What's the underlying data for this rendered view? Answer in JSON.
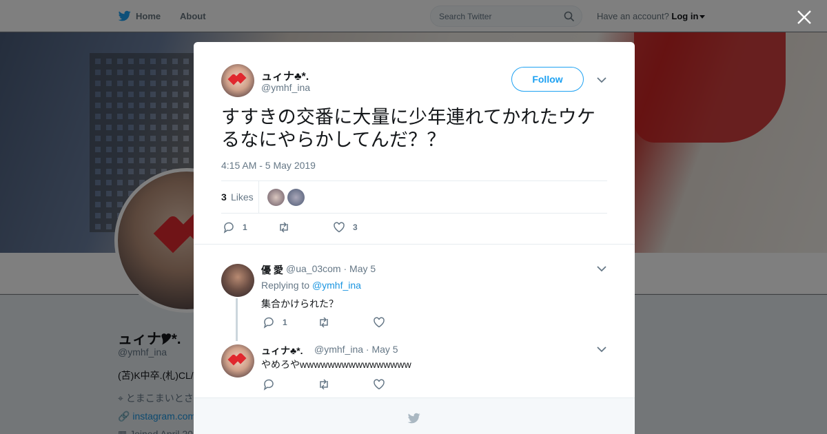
{
  "nav": {
    "home_label": "Home",
    "about_label": "About",
    "search_placeholder": "Search Twitter",
    "have_account": "Have an account?",
    "login_label": "Log in"
  },
  "profile": {
    "name": "ュィナ🎔*.",
    "handle": "@ymhf_ina",
    "bio": "(苫)K中卒.(札)CL/",
    "location": "とまこまいとさ",
    "link": "instagram.com",
    "joined": "Joined April 20"
  },
  "tweet": {
    "author_name": "ュィナ♣*.",
    "author_handle": "@ymhf_ina",
    "follow_label": "Follow",
    "text": "すすきの交番に大量に少年連れてかれたウケるなにやらかしてんだ？？",
    "timestamp": "4:15 AM - 5 May 2019",
    "likes_count": "3",
    "likes_label": "Likes",
    "reply_count": "1",
    "retweet_count": "",
    "like_count": "3"
  },
  "replies": [
    {
      "author_name": "優 愛",
      "author_handle": "@ua_03com",
      "date": "· May 5",
      "replying_to_prefix": "Replying to",
      "replying_to": "@ymhf_ina",
      "text": "集合かけられた？",
      "reply_count": "1"
    },
    {
      "author_name": "ュィナ♣*.",
      "author_handle": "@ymhf_ina",
      "date": "· May 5",
      "text": "やめろやwwwwwwwwwwwwwwww"
    }
  ],
  "colors": {
    "accent": "#1da1f2",
    "link": "#1b95e0",
    "muted": "#657786",
    "heart": "#e0282e"
  },
  "icons": [
    "twitter-bird-icon",
    "search-icon",
    "close-icon",
    "chevron-down-icon",
    "reply-icon",
    "retweet-icon",
    "like-icon",
    "location-icon",
    "link-icon",
    "calendar-icon"
  ]
}
